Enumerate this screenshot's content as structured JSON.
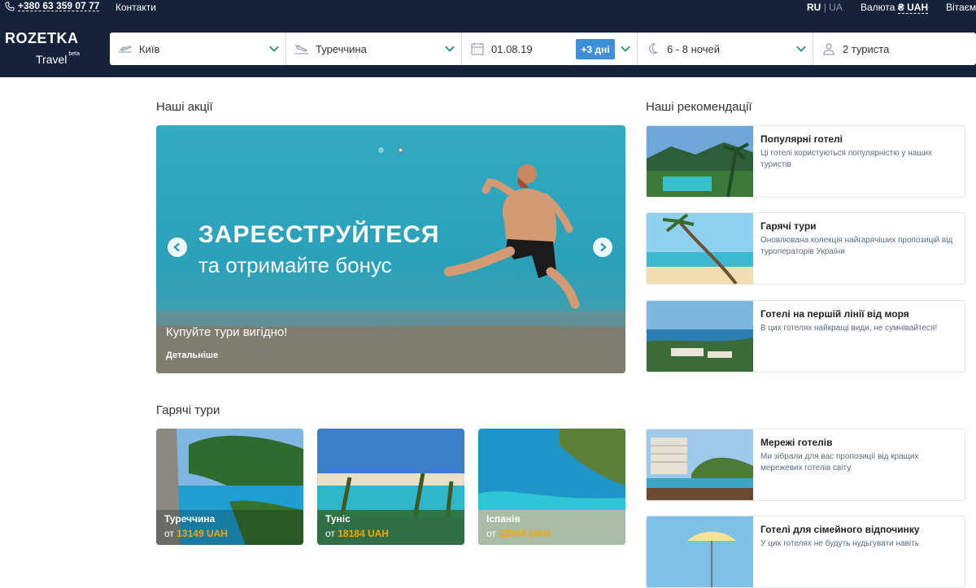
{
  "header": {
    "phone": "+380 63 359 07 77",
    "contacts": "Контакти",
    "lang_active": "RU",
    "lang_sep": "|",
    "lang_other": "UA",
    "currency_label": "Валюта",
    "currency_value": "₴ UAH",
    "welcome": "Вітаємо",
    "logo": "ROZETKA",
    "sublogo": "Travel",
    "beta": "beta"
  },
  "search": {
    "from": "Київ",
    "to": "Туреччина",
    "date": "01.08.19",
    "plus_days": "+3 дні",
    "nights": "6 - 8 ночей",
    "tourists": "2 туриста"
  },
  "promos": {
    "heading": "Наші акції",
    "headline": "ЗАРЕЄСТРУЙТЕСЯ",
    "subheadline": "та отримайте бонус",
    "caption": "Купуйте тури вигідно!",
    "details": "Детальніше"
  },
  "recommendations": {
    "heading": "Наші рекомендації",
    "items": [
      {
        "title": "Популярні готелі",
        "desc": "Ці готелі користуються популярністю у наших туристів"
      },
      {
        "title": "Гарячі тури",
        "desc": "Оновлювана колекція найгарячіших пропозицій від туроператорів України"
      },
      {
        "title": "Готелі на першій лінії від моря",
        "desc": "В цих готелях найкращі види, не сумнівайтеся!"
      },
      {
        "title": "Мережі готелів",
        "desc": "Ми зібрали для вас пропозиції від кращих мережевих готелів світу"
      },
      {
        "title": "Готелі для сімейного відпочинку",
        "desc": "У цих готелях не будуть нудьгувати навіть"
      }
    ]
  },
  "hot_tours": {
    "heading": "Гарячі тури",
    "prefix": "от",
    "items": [
      {
        "country": "Туреччина",
        "price": "13149 UAH"
      },
      {
        "country": "Туніс",
        "price": "18184 UAH"
      },
      {
        "country": "Іспанія",
        "price": "22843 UAH"
      }
    ]
  },
  "colors": {
    "header_bg": "#15223a",
    "accent": "#3d8fd8",
    "price": "#f7a600"
  }
}
